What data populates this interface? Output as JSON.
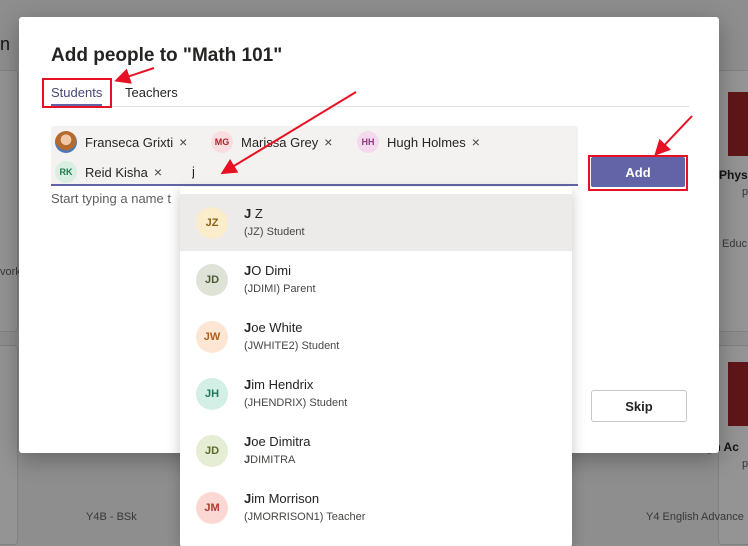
{
  "dialog": {
    "title": "Add people to \"Math 101\"",
    "tabs": [
      {
        "label": "Students",
        "active": true
      },
      {
        "label": "Teachers",
        "active": false
      }
    ],
    "chips": [
      {
        "initials": "",
        "name": "Franseca Grixti",
        "avatar_color": "#c87f3f",
        "avatar_text_color": "#ffffff",
        "has_photo": true
      },
      {
        "initials": "MG",
        "name": "Marissa Grey",
        "avatar_color": "#fbdde0",
        "avatar_text_color": "#a4262c"
      },
      {
        "initials": "HH",
        "name": "Hugh Holmes",
        "avatar_color": "#f4d9ef",
        "avatar_text_color": "#8e3a80"
      },
      {
        "initials": "RK",
        "name": "Reid Kisha",
        "avatar_color": "#d8efe2",
        "avatar_text_color": "#237b4b"
      }
    ],
    "remove_glyph": "×",
    "input_value": "j",
    "hint": "Start typing a name t",
    "add_label": "Add",
    "skip_label": "Skip"
  },
  "dropdown": {
    "items": [
      {
        "initials": "JZ",
        "bold": "J",
        "rest": " Z",
        "sub_bold": "",
        "sub": "(JZ) Student",
        "bg": "#fbeccb",
        "fg": "#8a6116",
        "selected": true
      },
      {
        "initials": "JD",
        "bold": "J",
        "rest": "O Dimi",
        "sub_bold": "",
        "sub": "(JDIMI) Parent",
        "bg": "#dfe3d7",
        "fg": "#4e5b3a",
        "selected": false
      },
      {
        "initials": "JW",
        "bold": "J",
        "rest": "oe White",
        "sub_bold": "",
        "sub": "(JWHITE2) Student",
        "bg": "#fde6d4",
        "fg": "#ad5f1d",
        "selected": false
      },
      {
        "initials": "JH",
        "bold": "J",
        "rest": "im Hendrix",
        "sub_bold": "",
        "sub": "(JHENDRIX) Student",
        "bg": "#d4efe6",
        "fg": "#1e7a5c",
        "selected": false
      },
      {
        "initials": "JD",
        "bold": "J",
        "rest": "oe Dimitra",
        "sub_bold": "J",
        "sub": "DIMITRA",
        "bg": "#e6edd5",
        "fg": "#5b6b2f",
        "selected": false
      },
      {
        "initials": "JM",
        "bold": "J",
        "rest": "im Morrison",
        "sub_bold": "",
        "sub": "(JMORRISON1) Teacher",
        "bg": "#fbd8d4",
        "fg": "#b0392f",
        "selected": false
      }
    ]
  },
  "background": {
    "left_edge_text_top": "n",
    "left_edge_text_mid": "vork",
    "right_title_1": "Phys",
    "right_sub_1": "p",
    "right_text_1": "Educ",
    "right_title_2": "gh Ac",
    "right_sub_2": "p",
    "bottom_left": "Y4B - BSk",
    "bottom_right": "Y4 English Advance"
  },
  "colors": {
    "accent": "#6264a7",
    "highlight": "#e81123"
  }
}
